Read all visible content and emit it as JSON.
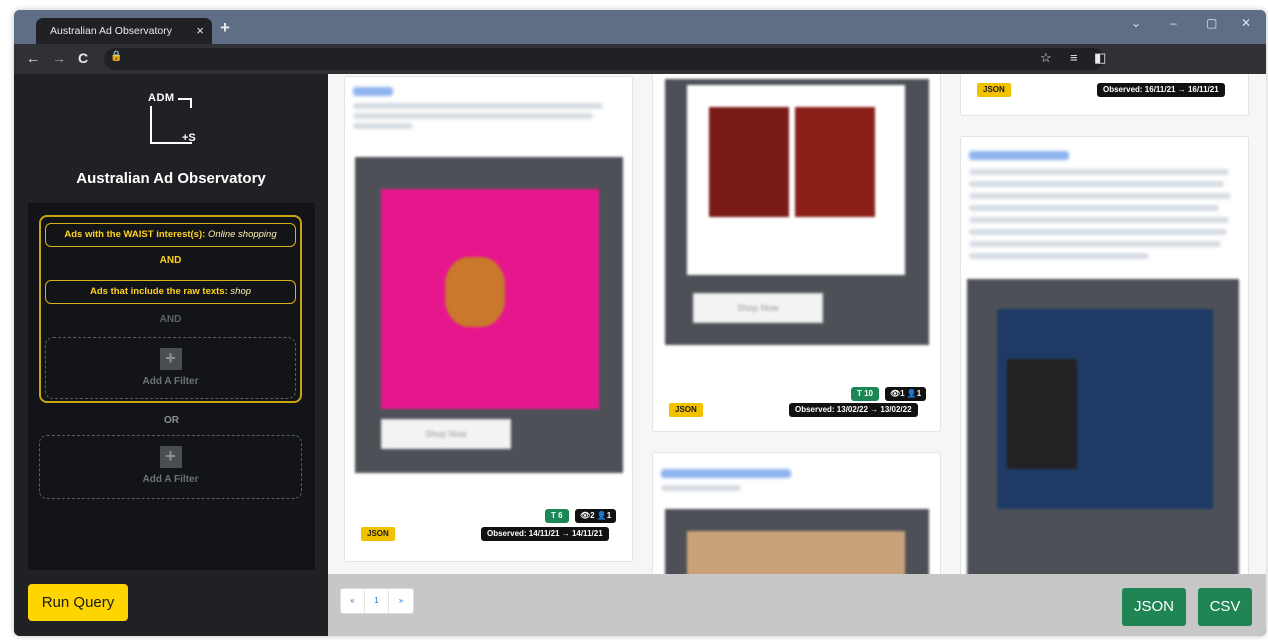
{
  "browser": {
    "tab_title": "Australian Ad Observatory",
    "tab_close": "×",
    "new_tab": "+",
    "controls": {
      "minimize_chevron": "⌄",
      "minimize": "–",
      "maximize": "▢",
      "close": "✕"
    },
    "nav": {
      "back": "←",
      "forward": "→",
      "reload": "C"
    },
    "toolbar_icons": [
      "star-icon",
      "reading-list-icon",
      "side-panel-icon"
    ]
  },
  "sidebar": {
    "logo": {
      "top": "ADM",
      "bottom": "+S"
    },
    "app_name": "Australian Ad Observatory",
    "filter_group": {
      "filter1": {
        "prefix": "Ads with the WAIST interest(s):",
        "value": "Online shopping"
      },
      "and_label": "AND",
      "filter2": {
        "prefix": "Ads that include the raw texts:",
        "value": "shop"
      },
      "and_label_inactive": "AND",
      "add_filter": "Add A Filter"
    },
    "or_label": "OR",
    "add_filter_or": "Add A Filter",
    "run_query": "Run Query"
  },
  "results": {
    "cards": [
      {
        "json": "JSON",
        "tokens": "T 6",
        "stats": "👁2 👤1",
        "observed": "Observed: 14/11/21 → 14/11/21"
      },
      {
        "json": "JSON",
        "tokens": "T 10",
        "stats": "👁1 👤1",
        "observed": "Observed: 13/02/22 → 13/02/22"
      },
      {
        "json": "JSON",
        "observed": "Observed: 16/11/21 → 16/11/21"
      }
    ]
  },
  "pagination": {
    "prev": "«",
    "page": "1",
    "next": "»"
  },
  "export": {
    "json": "JSON",
    "csv": "CSV"
  },
  "colors": {
    "accent_yellow": "#ffd500",
    "green": "#1f8554",
    "titlebar": "#5d6e85"
  }
}
